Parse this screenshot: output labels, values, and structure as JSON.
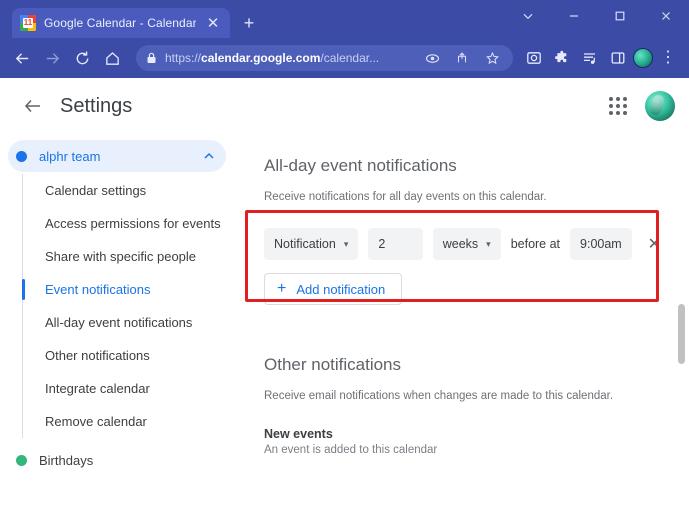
{
  "browser": {
    "tab": {
      "title": "Google Calendar - Calendar setti",
      "favicon_name": "google-calendar-favicon",
      "favicon_text": "11",
      "close_label": "✕"
    },
    "new_tab_label": "+",
    "window_controls": {
      "list_label": "⌄",
      "minimize_label": "–",
      "maximize_label": "□",
      "close_label": "✕"
    },
    "nav": {
      "back_label": "←",
      "forward_label": "→",
      "reload_label": "↻",
      "home_label": "⌂"
    },
    "omnibox": {
      "scheme": "https://",
      "host": "calendar.google.com",
      "path": "/calendar...",
      "lock_icon": "lock-icon"
    },
    "omni_icons": [
      "eye-icon",
      "share-icon",
      "star-icon"
    ],
    "toolbar_icons": [
      "screenshot-icon",
      "extensions-puzzle-icon",
      "reading-list-icon",
      "side-panel-icon"
    ],
    "kebab_label": "⋮"
  },
  "header": {
    "back_label": "←",
    "title": "Settings",
    "apps_icon": "apps-grid-icon",
    "avatar_name": "user-avatar"
  },
  "sidebar": {
    "groups": [
      {
        "name": "alphr team",
        "dot_color": "#1a73e8",
        "active": true,
        "items": [
          {
            "label": "Calendar settings",
            "selected": false
          },
          {
            "label": "Access permissions for events",
            "selected": false
          },
          {
            "label": "Share with specific people",
            "selected": false
          },
          {
            "label": "Event notifications",
            "selected": true
          },
          {
            "label": "All-day event notifications",
            "selected": false
          },
          {
            "label": "Other notifications",
            "selected": false
          },
          {
            "label": "Integrate calendar",
            "selected": false
          },
          {
            "label": "Remove calendar",
            "selected": false
          }
        ]
      },
      {
        "name": "Birthdays",
        "dot_color": "#33b679",
        "active": false,
        "items": []
      }
    ]
  },
  "main": {
    "allday": {
      "title": "All-day event notifications",
      "description": "Receive notifications for all day events on this calendar.",
      "notification": {
        "type_label": "Notification",
        "type_caret": "▾",
        "amount_value": "2",
        "unit_label": "weeks",
        "unit_caret": "▾",
        "before_at_label": "before at",
        "time_value": "9:00am",
        "remove_label": "✕"
      },
      "add_button": {
        "plus": "+",
        "label": "Add notification"
      }
    },
    "other": {
      "title": "Other notifications",
      "description": "Receive email notifications when changes are made to this calendar.",
      "rows": [
        {
          "name": "New events",
          "desc": "An event is added to this calendar"
        }
      ]
    },
    "highlight_color": "#e02020"
  }
}
